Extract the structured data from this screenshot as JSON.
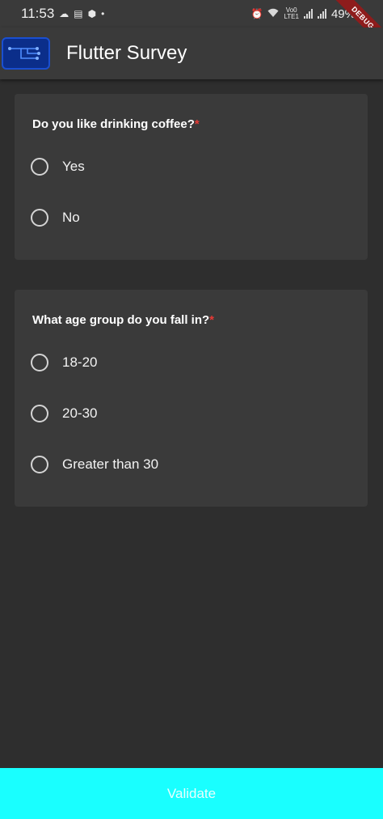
{
  "status_bar": {
    "time": "11:53",
    "dot": "•",
    "left_icons": [
      "cloud-icon",
      "notes-icon",
      "shield-icon"
    ],
    "right_icons": [
      "alarm-icon",
      "wifi-icon"
    ],
    "volte_line1": "Vo0",
    "volte_line2": "LTE1",
    "battery": "49%"
  },
  "debug_banner": "DEBUG",
  "app_bar": {
    "title": "Flutter Survey",
    "logo_icon": "circuit-icon"
  },
  "questions": [
    {
      "text": "Do you like drinking coffee?",
      "required_mark": "*",
      "options": [
        "Yes",
        "No"
      ]
    },
    {
      "text": "What age group do you fall in?",
      "required_mark": "*",
      "options": [
        "18-20",
        "20-30",
        "Greater than 30"
      ]
    }
  ],
  "validate_label": "Validate",
  "colors": {
    "background": "#2e2e2e",
    "card": "#3a3a3a",
    "accent": "#19ffff",
    "required": "#e53935"
  }
}
